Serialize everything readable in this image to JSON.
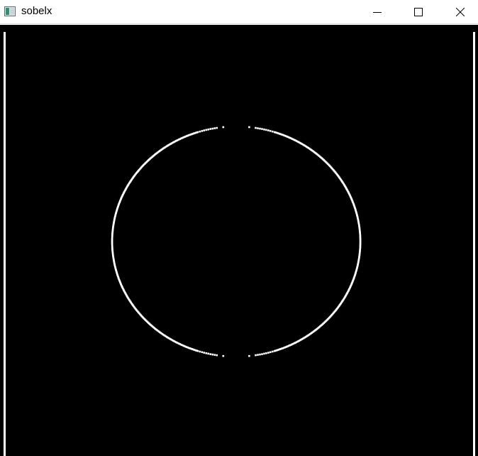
{
  "window": {
    "title": "sobelx",
    "controls": {
      "minimize_icon": "minimize-icon",
      "maximize_icon": "maximize-icon",
      "close_icon": "close-icon"
    }
  },
  "image": {
    "background_color": "#000000",
    "edge_color": "#ffffff"
  }
}
